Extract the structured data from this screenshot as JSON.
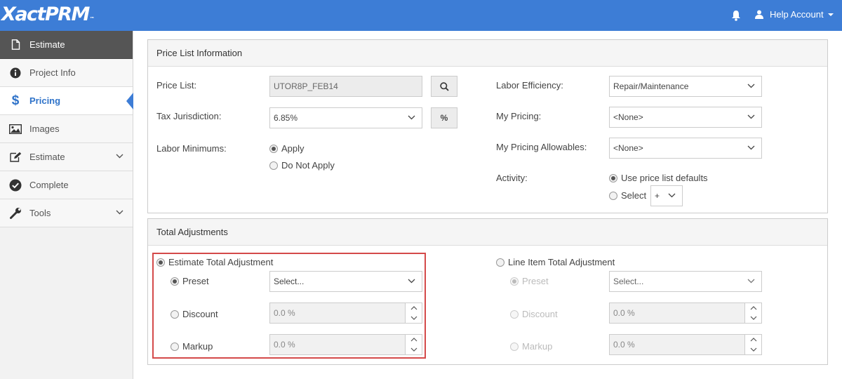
{
  "app": {
    "logo": "XactPRM",
    "logo_tm": "™"
  },
  "header": {
    "account_label": "Help Account"
  },
  "sidebar": {
    "items": [
      {
        "label": "Estimate",
        "icon": "document-icon"
      },
      {
        "label": "Project Info",
        "icon": "info-icon"
      },
      {
        "label": "Pricing",
        "icon": "dollar-icon"
      },
      {
        "label": "Images",
        "icon": "image-icon"
      },
      {
        "label": "Estimate",
        "icon": "edit-icon"
      },
      {
        "label": "Complete",
        "icon": "check-circle-icon"
      },
      {
        "label": "Tools",
        "icon": "wrench-icon"
      }
    ]
  },
  "price_list_panel": {
    "title": "Price List Information",
    "price_list": {
      "label": "Price List:",
      "value": "UTOR8P_FEB14"
    },
    "tax_jurisdiction": {
      "label": "Tax Jurisdiction:",
      "value": "6.85%",
      "button": "%"
    },
    "labor_minimums": {
      "label": "Labor Minimums:",
      "options": [
        "Apply",
        "Do Not Apply"
      ],
      "selected": "Apply"
    },
    "labor_efficiency": {
      "label": "Labor Efficiency:",
      "value": "Repair/Maintenance"
    },
    "my_pricing": {
      "label": "My Pricing:",
      "value": "<None>"
    },
    "my_pricing_allowables": {
      "label": "My Pricing Allowables:",
      "value": "<None>"
    },
    "activity": {
      "label": "Activity:",
      "options": [
        "Use price list defaults",
        "Select"
      ],
      "selected": "Use price list defaults",
      "select_value": "+"
    }
  },
  "total_adjustments_panel": {
    "title": "Total Adjustments",
    "estimate_total": {
      "label": "Estimate Total Adjustment",
      "preset_label": "Preset",
      "preset_value": "Select...",
      "discount_label": "Discount",
      "discount_value": "0.0 %",
      "markup_label": "Markup",
      "markup_value": "0.0 %"
    },
    "line_item_total": {
      "label": "Line Item Total Adjustment",
      "preset_label": "Preset",
      "preset_value": "Select...",
      "discount_label": "Discount",
      "discount_value": "0.0 %",
      "markup_label": "Markup",
      "markup_value": "0.0 %"
    }
  },
  "colors": {
    "brand_blue": "#3d7dd6",
    "highlight_red": "#d44a4a",
    "sidebar_header": "#555555"
  }
}
